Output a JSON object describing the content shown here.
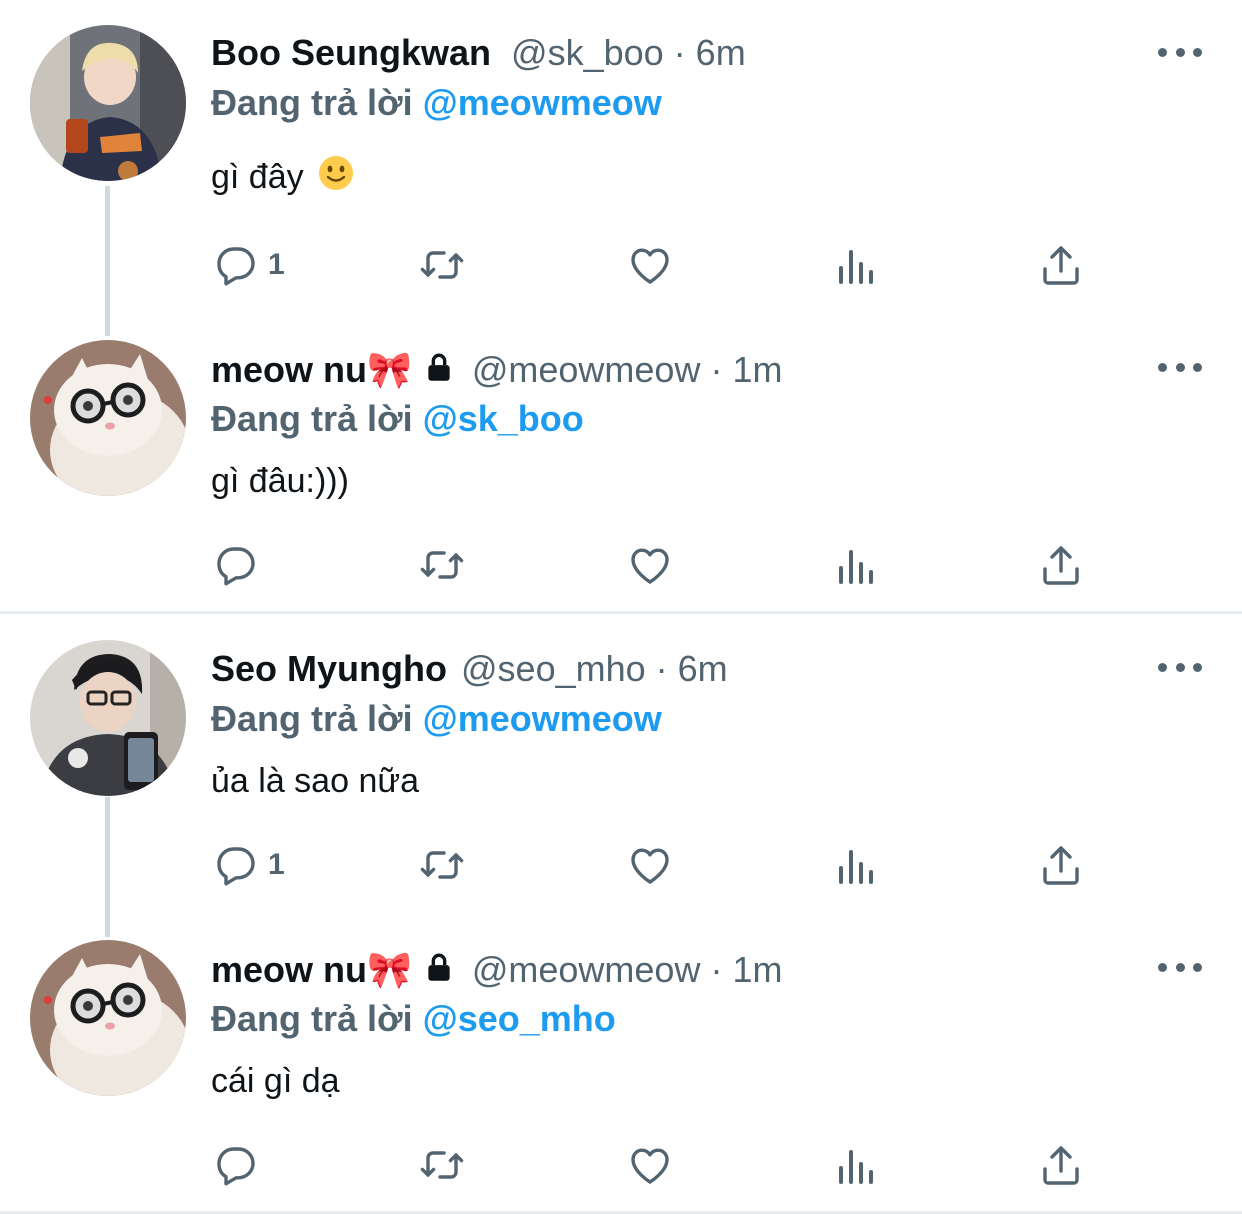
{
  "tweets": [
    {
      "name": "Boo Seungkwan",
      "handle": "@sk_boo",
      "time": "6m",
      "replying_prefix": "Đang trả lời",
      "replying_to": "@meowmeow",
      "text": "gì đây",
      "emoji": "slightly-smiling-face",
      "reply_count": "1",
      "avatar": "person-avatar-blonde"
    },
    {
      "name": "meow nu🎀",
      "handle": "@meowmeow",
      "time": "1m",
      "replying_prefix": "Đang trả lời",
      "replying_to": "@sk_boo",
      "text": "gì đâu:)))",
      "reply_count": "",
      "avatar": "cat-with-glasses-avatar",
      "locked": true
    },
    {
      "name": "Seo Myungho",
      "handle": "@seo_mho",
      "time": "6m",
      "replying_prefix": "Đang trả lời",
      "replying_to": "@meowmeow",
      "text": "ủa là sao nữa",
      "reply_count": "1",
      "avatar": "person-avatar-dark-hair"
    },
    {
      "name": "meow nu🎀",
      "handle": "@meowmeow",
      "time": "1m",
      "replying_prefix": "Đang trả lời",
      "replying_to": "@seo_mho",
      "text": "cái gì dạ",
      "reply_count": "",
      "avatar": "cat-with-glasses-avatar",
      "locked": true
    }
  ],
  "colors": {
    "accent": "#1d9bf0",
    "secondary_text": "#536471",
    "primary_text": "#0f1419",
    "thread_line": "#cfd9de"
  }
}
